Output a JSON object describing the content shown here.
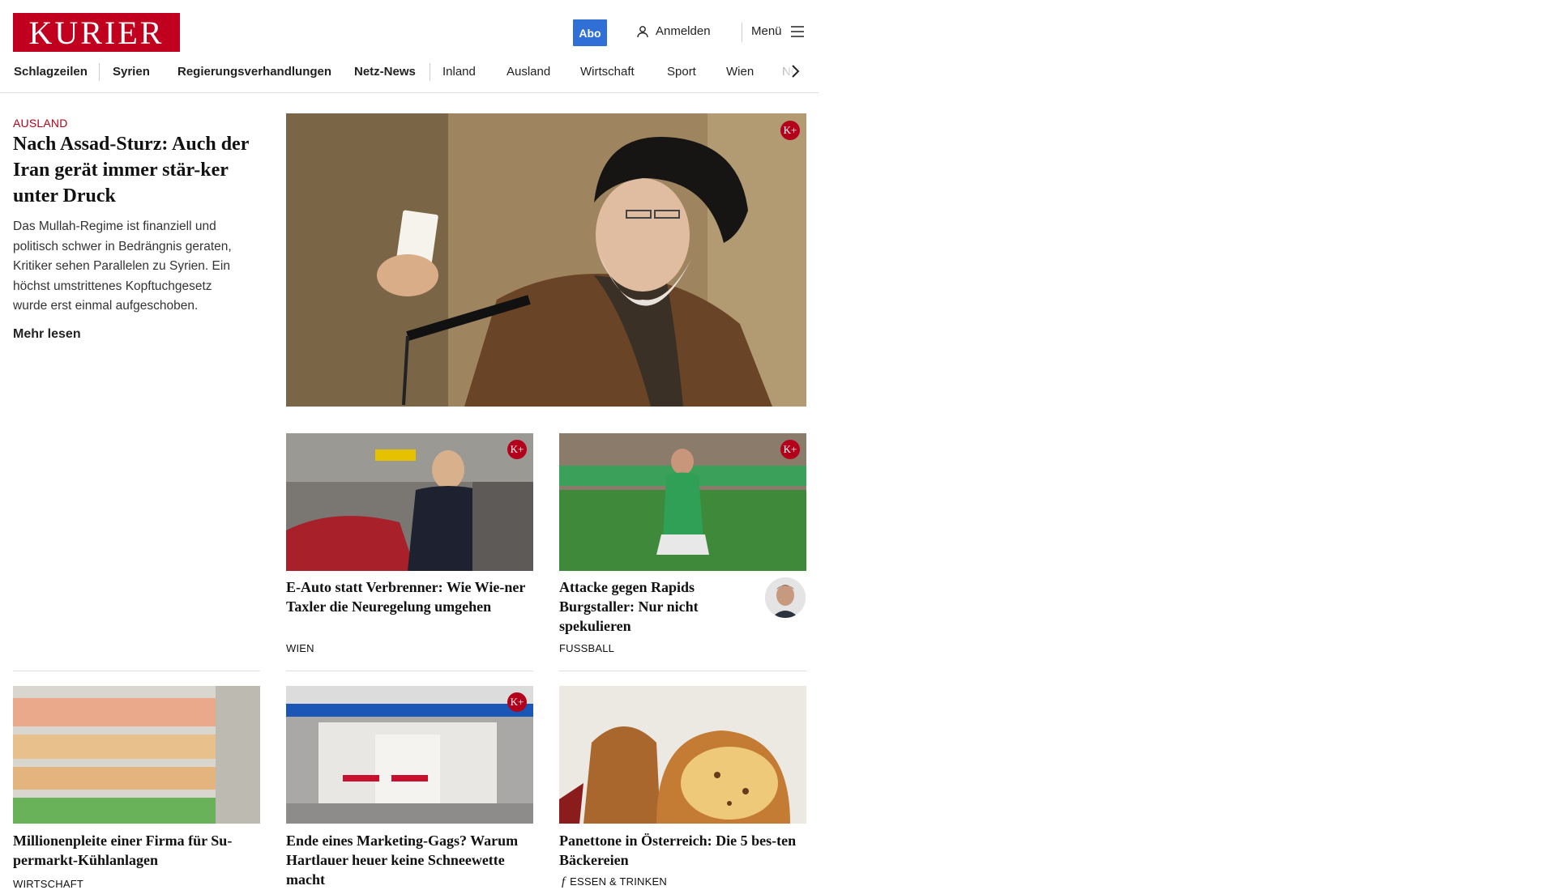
{
  "header": {
    "logo": "KURIER",
    "abo": "Abo",
    "login": "Anmelden",
    "menu": "Menü"
  },
  "nav": [
    "Schlagzeilen",
    "Syrien",
    "Regierungsverhandlungen",
    "Netz-News",
    "Inland",
    "Ausland",
    "Wirtschaft",
    "Sport",
    "Wien",
    "NÖ"
  ],
  "lead": {
    "kicker": "AUSLAND",
    "headline": "Nach Assad-Sturz: Auch der Iran gerät immer stär-ker unter Druck",
    "teaser": "Das Mullah-Regime ist finanziell und politisch schwer in Bedrängnis geraten, Kritiker sehen Parallelen zu Syrien. Ein höchst umstrittenes Kopftuchgesetz wurde erst einmal aufgeschoben.",
    "more": "Mehr lesen",
    "badge": "K+"
  },
  "articles": [
    {
      "headline": "E-Auto statt Verbrenner: Wie Wie-ner Taxler die Neuregelung umgehen",
      "kicker": "WIEN",
      "badge": "K+"
    },
    {
      "headline": "Attacke gegen Rapids Burgstaller: Nur nicht spekulieren",
      "kicker": "FUSSBALL",
      "badge": "K+"
    },
    {
      "headline": "Millionenpleite einer Firma für Su-permarkt-Kühlanlagen",
      "kicker": "WIRTSCHAFT"
    },
    {
      "headline": "Ende eines Marketing-Gags? Warum Hartlauer heuer keine Schneewette macht",
      "kicker": "",
      "badge": "K+"
    },
    {
      "headline": "Panettone in Österreich: Die 5 bes-ten Bäckereien",
      "kicker": "ESSEN & TRINKEN"
    }
  ],
  "colors": {
    "brand": "#c1001f",
    "abo": "#2f6fd6",
    "kicker_lead": "#b3001b"
  }
}
